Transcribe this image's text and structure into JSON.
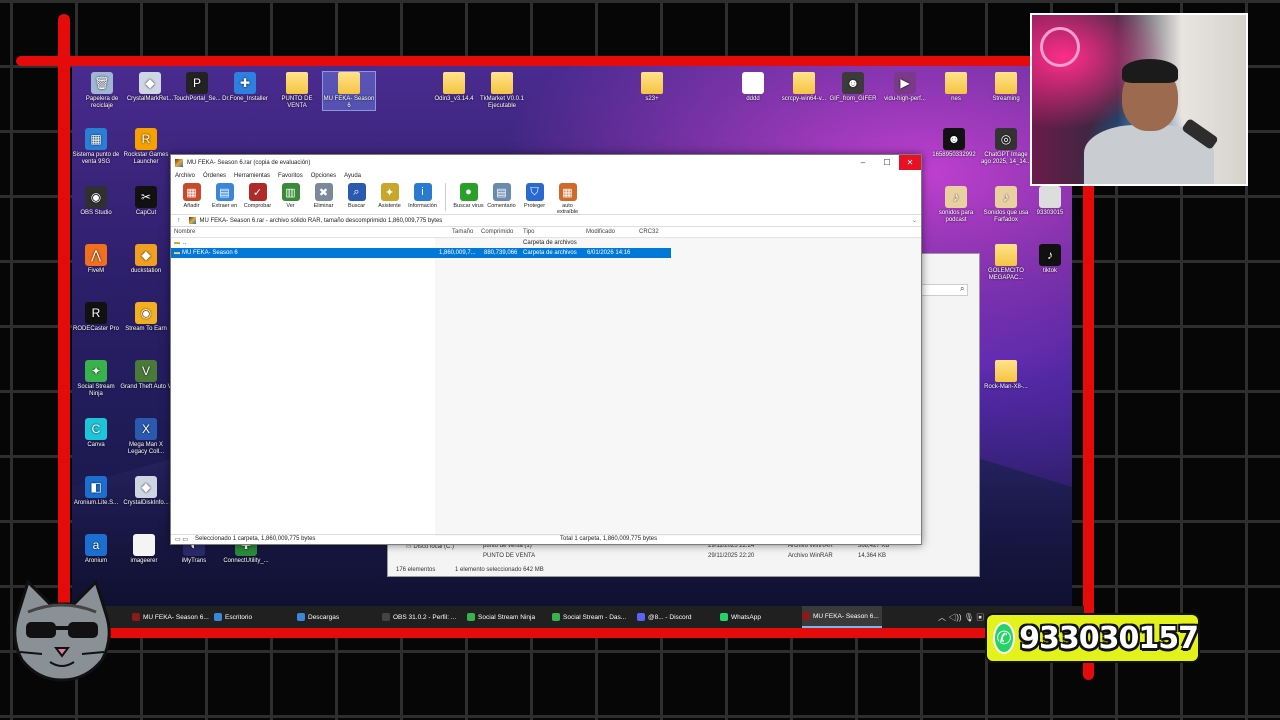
{
  "desktop_icons": [
    {
      "label": "Papelera de reciclaje",
      "type": "file",
      "color": "#9fb7d4",
      "glyph": "🗑"
    },
    {
      "label": "CrystalMarkRet...",
      "type": "file",
      "color": "#cfd6e3",
      "glyph": "◆"
    },
    {
      "label": "TouchPortal_Se...",
      "type": "file",
      "color": "#222222",
      "glyph": "P"
    },
    {
      "label": "Dr.Fone_Installer",
      "type": "file",
      "color": "#2d7fe0",
      "glyph": "✚"
    },
    {
      "label": "PUNTO DE VENTA",
      "type": "folder",
      "color": "",
      "glyph": ""
    },
    {
      "label": "MU FEKA- Season 6",
      "type": "folder",
      "color": "",
      "glyph": "",
      "selected": true
    },
    {
      "label": "Odin3_v3.14.4",
      "type": "folder",
      "color": "",
      "glyph": ""
    },
    {
      "label": "TkMarket V0.0.1 Ejecutable",
      "type": "folder",
      "color": "",
      "glyph": ""
    },
    {
      "label": "s23+",
      "type": "folder",
      "color": "",
      "glyph": ""
    },
    {
      "label": "dddd",
      "type": "file",
      "color": "#ffffff",
      "glyph": ""
    },
    {
      "label": "scrcpy-win64-v...",
      "type": "folder",
      "color": "",
      "glyph": ""
    },
    {
      "label": "GIF_from_GIFER",
      "type": "file",
      "color": "#3b3b3b",
      "glyph": "☻"
    },
    {
      "label": "vidu-high-perf...",
      "type": "file",
      "color": "#7a3a8a",
      "glyph": "▶"
    },
    {
      "label": "nes",
      "type": "folder",
      "color": "",
      "glyph": ""
    },
    {
      "label": "Streaming",
      "type": "folder",
      "color": "",
      "glyph": ""
    },
    {
      "label": "Sistema punto de venta 9SG",
      "type": "file",
      "color": "#2a7fd4",
      "glyph": "▦"
    },
    {
      "label": "Rockstar Games Launcher",
      "type": "file",
      "color": "#f5a100",
      "glyph": "R"
    },
    {
      "label": "1658950332992",
      "type": "file",
      "color": "#111111",
      "glyph": "☻"
    },
    {
      "label": "ChatGPT Image ago 2025, 14_14...",
      "type": "file",
      "color": "#333333",
      "glyph": "◎"
    },
    {
      "label": "OBS Studio",
      "type": "file",
      "color": "#303030",
      "glyph": "◉"
    },
    {
      "label": "CapCut",
      "type": "file",
      "color": "#111111",
      "glyph": "✂"
    },
    {
      "label": "sonidos para podcast",
      "type": "file",
      "color": "#e8d0a0",
      "glyph": "♪"
    },
    {
      "label": "Sonidos que usa Farfadox",
      "type": "file",
      "color": "#e8d0a0",
      "glyph": "♪"
    },
    {
      "label": "93303015",
      "type": "file",
      "color": "#dddddd",
      "glyph": ""
    },
    {
      "label": "FiveM",
      "type": "file",
      "color": "#f07020",
      "glyph": "⋀"
    },
    {
      "label": "duckstation",
      "type": "file",
      "color": "#f0a020",
      "glyph": "◆"
    },
    {
      "label": "GOLEMCITO MEGAPAC...",
      "type": "folder",
      "color": "",
      "glyph": ""
    },
    {
      "label": "tiktok",
      "type": "file",
      "color": "#111111",
      "glyph": "♪"
    },
    {
      "label": "RODECaster Pro",
      "type": "file",
      "color": "#111111",
      "glyph": "R"
    },
    {
      "label": "Stream To Earn",
      "type": "file",
      "color": "#f0b020",
      "glyph": "◉"
    },
    {
      "label": "Rock-Man-X8-...",
      "type": "folder",
      "color": "",
      "glyph": ""
    },
    {
      "label": "Social Stream Ninja",
      "type": "file",
      "color": "#38b24a",
      "glyph": "✦"
    },
    {
      "label": "Grand Theft Auto V",
      "type": "file",
      "color": "#4a7a3a",
      "glyph": "V"
    },
    {
      "label": "Canva",
      "type": "file",
      "color": "#1ec4d8",
      "glyph": "C"
    },
    {
      "label": "Mega Man X Legacy Coll...",
      "type": "file",
      "color": "#2a5ab0",
      "glyph": "X"
    },
    {
      "label": "Aronium.Lite.S...",
      "type": "file",
      "color": "#1c6fd0",
      "glyph": "◧"
    },
    {
      "label": "CrystalDiskInfo...",
      "type": "file",
      "color": "#cfd6e3",
      "glyph": "◆"
    },
    {
      "label": "Aronium",
      "type": "file",
      "color": "#1c6fd0",
      "glyph": "a"
    },
    {
      "label": "imageerer",
      "type": "file",
      "color": "#f4f4f4",
      "glyph": ""
    },
    {
      "label": "iMyTrans",
      "type": "file",
      "color": "#2a2a6a",
      "glyph": "◐"
    },
    {
      "label": "ConnectUtility_...",
      "type": "file",
      "color": "#2a8a3a",
      "glyph": "✚"
    }
  ],
  "winrar": {
    "title": "MU FEKA- Season 6.rar (copia de evaluación)",
    "menu": [
      "Archivo",
      "Órdenes",
      "Herramientas",
      "Favoritos",
      "Opciones",
      "Ayuda"
    ],
    "toolbar": [
      {
        "label": "Añadir",
        "color": "#c94a2a",
        "glyph": "▦"
      },
      {
        "label": "Extraer en",
        "color": "#3a86d8",
        "glyph": "▤"
      },
      {
        "label": "Comprobar",
        "color": "#b02a2a",
        "glyph": "✓"
      },
      {
        "label": "Ver",
        "color": "#3a8a3a",
        "glyph": "▥"
      },
      {
        "label": "Eliminar",
        "color": "#7a8a9a",
        "glyph": "✖"
      },
      {
        "label": "Buscar",
        "color": "#2a5ab0",
        "glyph": "⌕"
      },
      {
        "label": "Asistente",
        "color": "#c7a62a",
        "glyph": "✦"
      },
      {
        "label": "Información",
        "color": "#2a7ad0",
        "glyph": "i"
      },
      {
        "label": "Buscar virus",
        "color": "#2aa02a",
        "glyph": "●"
      },
      {
        "label": "Comentario",
        "color": "#6a8ab0",
        "glyph": "▤"
      },
      {
        "label": "Proteger",
        "color": "#2a6ad0",
        "glyph": "⛉"
      },
      {
        "label": "auto extraíble",
        "color": "#d06a2a",
        "glyph": "▦"
      }
    ],
    "path": "MU FEKA- Season 6.rar - archivo sólido RAR, tamaño descomprimido 1,860,009,775 bytes",
    "columns": {
      "name": "Nombre",
      "size": "Tamaño",
      "packed": "Comprimido",
      "type": "Tipo",
      "modified": "Modificado",
      "crc": "CRC32"
    },
    "rows": [
      {
        "name": "..",
        "size": "",
        "packed": "",
        "type": "Carpeta de archivos",
        "modified": "",
        "crc": ""
      },
      {
        "name": "MU FEKA- Season 6",
        "size": "1,860,009,7...",
        "packed": "880,739,066",
        "type": "Carpeta de archivos",
        "modified": "6/01/2026 14:16",
        "crc": ""
      }
    ],
    "status_left": "Seleccionado 1 carpeta, 1,860,009,775 bytes",
    "status_right": "Total 1 carpeta, 1,860,009,775 bytes"
  },
  "explorer": {
    "rows": [
      {
        "name": "Disco local (C:)",
        "item": "punto de venta (1)",
        "date": "29/11/2025 22:24",
        "type": "Archivo WinRAR",
        "size": "368,427 KB"
      },
      {
        "name": "",
        "item": "PUNTO DE VENTA",
        "date": "29/11/2025 22:20",
        "type": "Archivo WinRAR",
        "size": "14,364 KB"
      }
    ],
    "status_count": "176 elementos",
    "status_sel": "1 elemento seleccionado  642 MB"
  },
  "taskbar": {
    "items": [
      {
        "label": "MU FEKA- Season 6...",
        "color": "#8b1a1a"
      },
      {
        "label": "Escritorio",
        "color": "#3a86d8"
      },
      {
        "label": "Descargas",
        "color": "#3a86d8"
      },
      {
        "label": "OBS 31.0.2 - Perfil: ...",
        "color": "#444444"
      },
      {
        "label": "Social Stream Ninja",
        "color": "#38b24a"
      },
      {
        "label": "Social Stream - Das...",
        "color": "#38b24a"
      },
      {
        "label": "@8... - Discord",
        "color": "#5865f2"
      },
      {
        "label": "WhatsApp",
        "color": "#25d366"
      },
      {
        "label": "MU FEKA- Season 6...",
        "color": "#8b1a1a",
        "active": true
      }
    ]
  },
  "whatsapp": {
    "number": "933030157",
    "color": "#25d366"
  }
}
